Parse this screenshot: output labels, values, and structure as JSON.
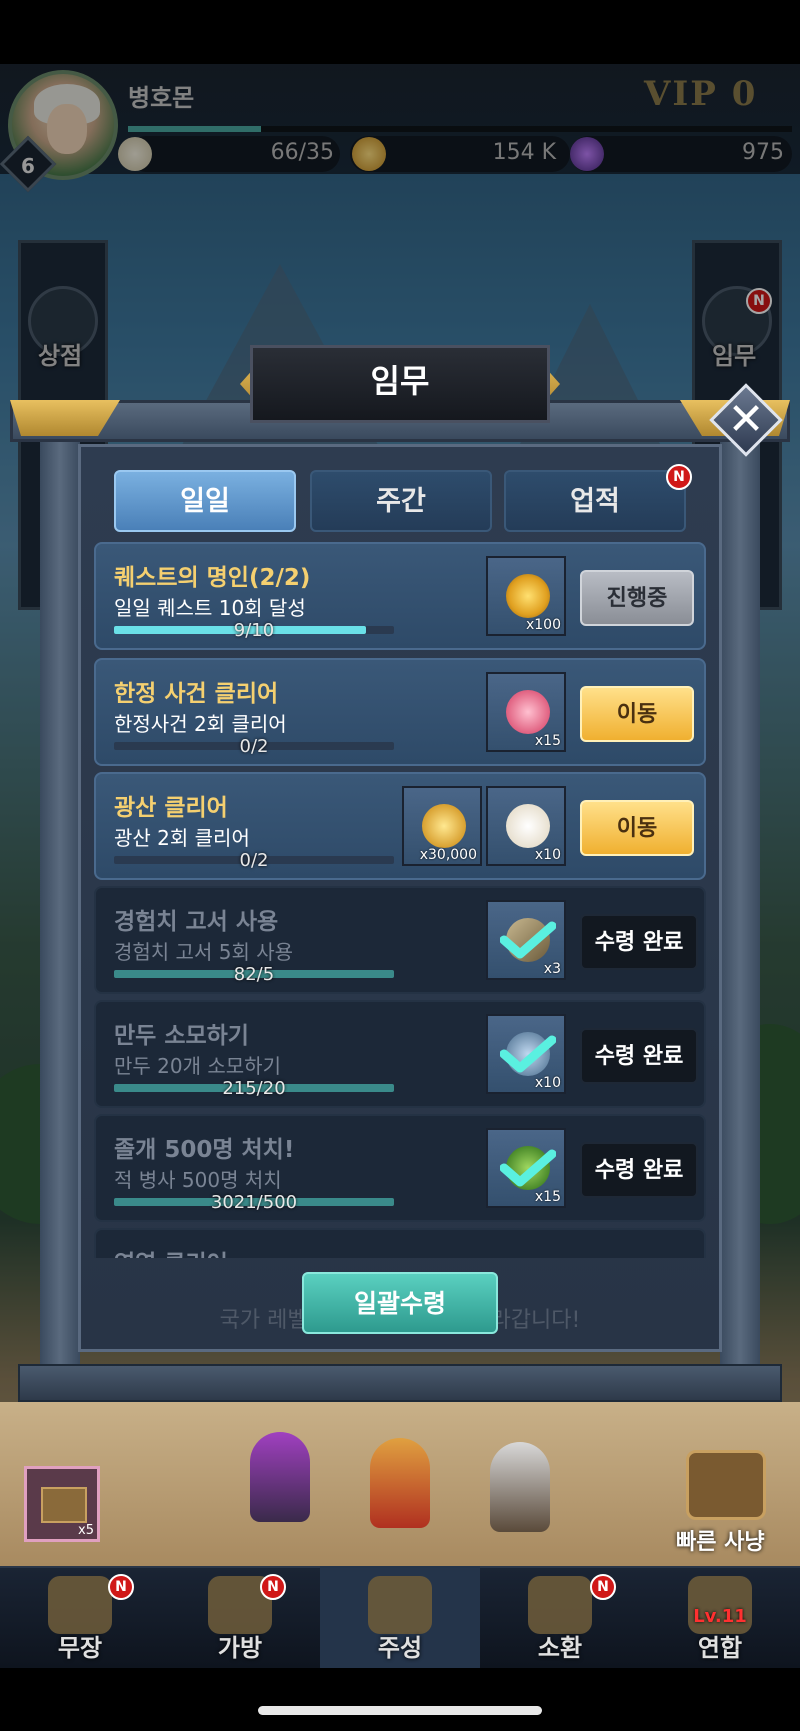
{
  "player": {
    "name": "병호몬",
    "level": "6",
    "vip": "VIP  0",
    "exp_fraction": 0.2
  },
  "resources": {
    "stamina": "66/35",
    "gold": "154 K",
    "gems": "975"
  },
  "side_menu": {
    "shop": "상점",
    "quest": "임무",
    "quest_badge": "N"
  },
  "modal": {
    "title": "임무",
    "close_icon": "close-icon",
    "tabs": [
      {
        "label": "일일",
        "active": true
      },
      {
        "label": "주간",
        "active": false
      },
      {
        "label": "업적",
        "active": false,
        "badge": "N"
      }
    ],
    "quests": [
      {
        "title": "퀘스트의 명인(2/2)",
        "desc": "일일 퀘스트 10회 달성",
        "progress": "9/10",
        "fill": 0.9,
        "rewards": [
          {
            "icon": "gold-coin-icon",
            "qty": "x100"
          }
        ],
        "button": "진행중",
        "state": "in-progress"
      },
      {
        "title": "한정 사건 클리어",
        "desc": "한정사건 2회 클리어",
        "progress": "0/2",
        "fill": 0,
        "rewards": [
          {
            "icon": "pink-gem-icon",
            "qty": "x15"
          }
        ],
        "button": "이동",
        "state": "go"
      },
      {
        "title": "광산 클리어",
        "desc": "광산 2회 클리어",
        "progress": "0/2",
        "fill": 0,
        "rewards": [
          {
            "icon": "gold-coins-icon",
            "qty": "x30,000"
          },
          {
            "icon": "bun-icon",
            "qty": "x10"
          }
        ],
        "button": "이동",
        "state": "go"
      },
      {
        "title": "경험치 고서 사용",
        "desc": "경험치 고서 5회 사용",
        "progress": "82/5",
        "fill": 1,
        "rewards": [
          {
            "icon": "exp-book-icon",
            "qty": "x3"
          }
        ],
        "button": "수령 완료",
        "state": "claimed"
      },
      {
        "title": "만두 소모하기",
        "desc": "만두 20개 소모하기",
        "progress": "215/20",
        "fill": 1,
        "rewards": [
          {
            "icon": "armor-icon",
            "qty": "x10"
          }
        ],
        "button": "수령 완료",
        "state": "claimed"
      },
      {
        "title": "졸개 500명 처치!",
        "desc": "적 병사 500명 처치",
        "progress": "3021/500",
        "fill": 1,
        "rewards": [
          {
            "icon": "green-item-icon",
            "qty": "x15"
          }
        ],
        "button": "수령 완료",
        "state": "claimed"
      },
      {
        "title": "영역 클리어",
        "desc": "",
        "progress": "",
        "fill": 0,
        "rewards": [],
        "button": "",
        "state": "partial"
      }
    ],
    "claim_all": "일괄수령",
    "notice": "국가 레벨이 오르면 보상도 올라갑니다!"
  },
  "bottom": {
    "slot_qty": "x5",
    "fast_hunt": "빠른 사냥",
    "nav": [
      {
        "label": "무장",
        "badge": "N"
      },
      {
        "label": "가방",
        "badge": "N"
      },
      {
        "label": "주성",
        "active": true
      },
      {
        "label": "소환",
        "badge": "N"
      },
      {
        "label": "연합",
        "extra": "Lv.11"
      }
    ]
  },
  "colors": {
    "title_gold": "#f0c860",
    "done_text": "#7a8494",
    "active_title": "#f5d070",
    "progress_teal": "#6ae0e8"
  }
}
